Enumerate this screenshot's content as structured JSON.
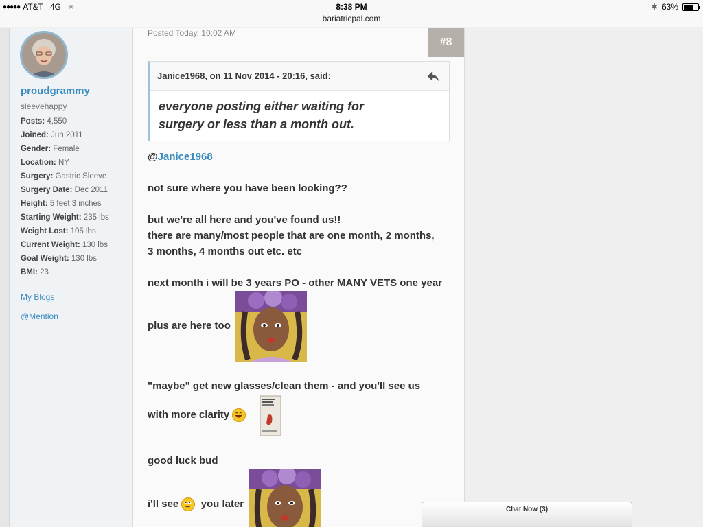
{
  "status_bar": {
    "carrier": "AT&T",
    "network": "4G",
    "time": "8:38 PM",
    "url": "bariatricpal.com",
    "battery_percent": "63%",
    "battery_level": 0.63
  },
  "author": {
    "username": "proudgrammy",
    "title": "sleevehappy",
    "stats": [
      {
        "label": "Posts:",
        "value": "4,550"
      },
      {
        "label": "Joined:",
        "value": "Jun 2011"
      },
      {
        "label": "Gender:",
        "value": "Female"
      },
      {
        "label": "Location:",
        "value": "NY"
      },
      {
        "label": "Surgery:",
        "value": "Gastric Sleeve"
      },
      {
        "label": "Surgery Date:",
        "value": "Dec 2011"
      },
      {
        "label": "Height:",
        "value": "5 feet 3 inches"
      },
      {
        "label": "Starting Weight:",
        "value": "235 lbs"
      },
      {
        "label": "Weight Lost:",
        "value": "105 lbs"
      },
      {
        "label": "Current Weight:",
        "value": "130 lbs"
      },
      {
        "label": "Goal Weight:",
        "value": "130 lbs"
      },
      {
        "label": "BMI:",
        "value": "23"
      }
    ],
    "blogs_link": "My Blogs",
    "mention_link": "@Mention"
  },
  "post": {
    "posted_label": "Posted",
    "posted_time": "Today, 10:02 AM",
    "number": "#8",
    "quote": {
      "cite": "Janice1968, on 11 Nov 2014 - 20:16, said:",
      "line1": "everyone posting  either waiting for",
      "line2": "surgery or less than a month out."
    },
    "mention_at": "@",
    "mention_name": "Janice1968",
    "lines": {
      "l1": "not sure where you have been looking??",
      "l2": "but we're all here and you've found us!!",
      "l3": "there are many/most people that are one month, 2 months,",
      "l4": "3 months, 4 months out etc. etc",
      "l5": "next month i will be 3 years PO - other MANY VETS one year",
      "l6": "plus are here too",
      "l7": "\"maybe\" get new glasses/clean them -  and you'll see us",
      "l8": "with more clarity",
      "l9": "good luck bud",
      "l10a": "i'll see",
      "l10b": "you later"
    }
  },
  "chat": {
    "label": "Chat Now (3)"
  }
}
